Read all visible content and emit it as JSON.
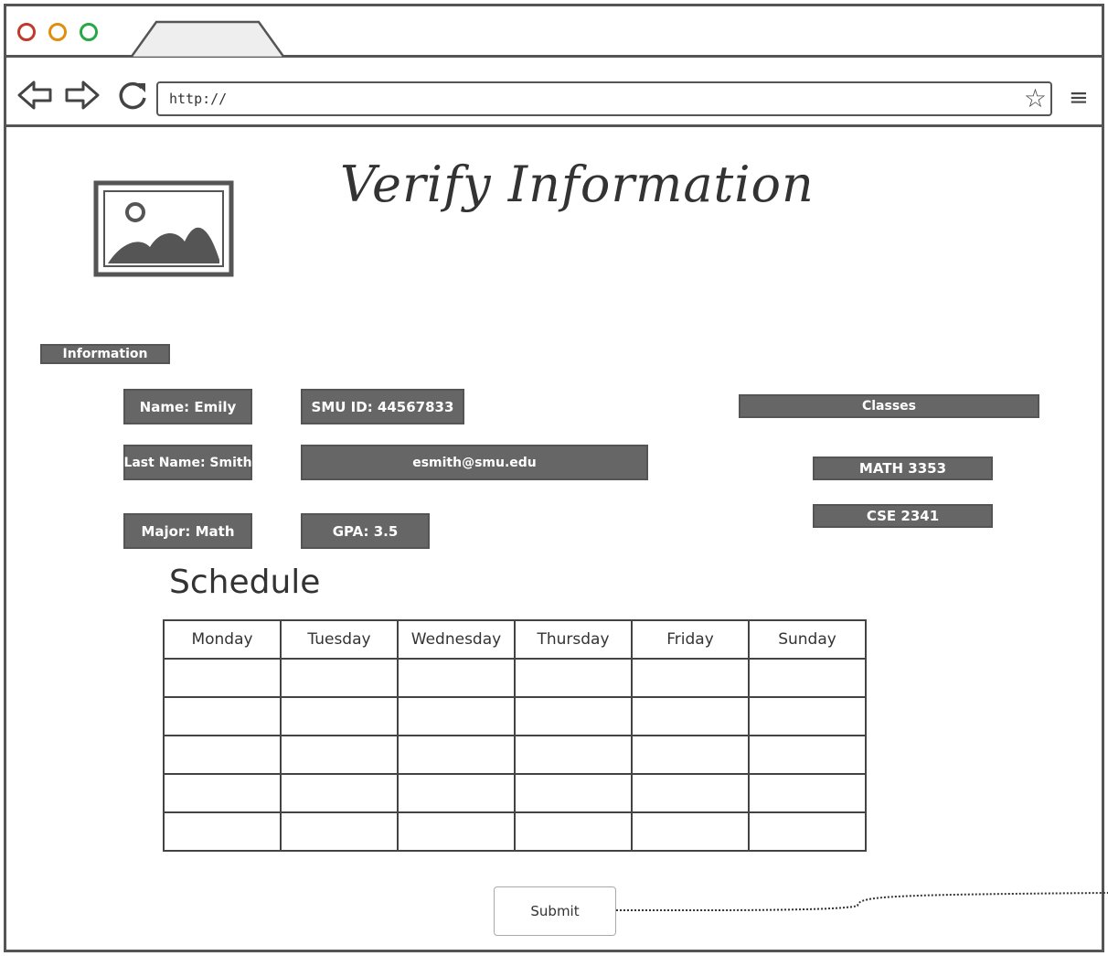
{
  "browser": {
    "url": "http://"
  },
  "page": {
    "title": "Verify Information"
  },
  "information": {
    "section_label": "Information",
    "name": "Name: Emily",
    "last_name": "Last Name: Smith",
    "major": "Major: Math",
    "smu_id": "SMU ID: 44567833",
    "email": "esmith@smu.edu",
    "gpa": "GPA: 3.5"
  },
  "classes": {
    "header": "Classes",
    "items": [
      "MATH 3353",
      "CSE 2341"
    ]
  },
  "schedule": {
    "title": "Schedule",
    "days": [
      "Monday",
      "Tuesday",
      "Wednesday",
      "Thursday",
      "Friday",
      "Sunday"
    ]
  },
  "submit_label": "Submit",
  "icons": {
    "back": "arrow-left-icon",
    "forward": "arrow-right-icon",
    "reload": "reload-icon",
    "bookmark": "star-icon",
    "menu": "hamburger-menu-icon",
    "image": "image-placeholder-icon"
  },
  "colors": {
    "frame": "#555555",
    "dark_box": "#666666",
    "close_dot": "#c0392b",
    "minimize_dot": "#e08e0b",
    "maximize_dot": "#27a844"
  }
}
